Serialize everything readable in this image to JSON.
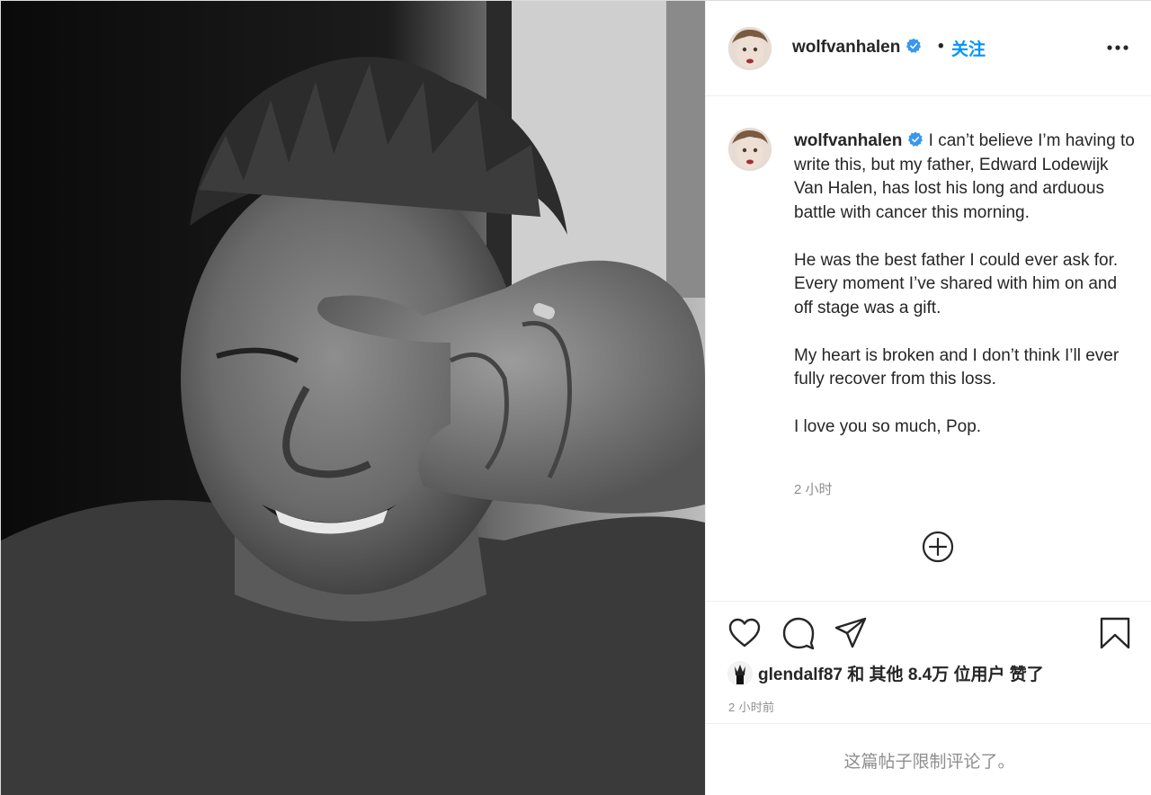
{
  "photo": {
    "description_icon": "photo-black-and-white"
  },
  "header": {
    "username": "wolfvanhalen",
    "separator": "•",
    "follow_label": "关注",
    "more_icon": "more-horizontal-icon"
  },
  "caption": {
    "username": "wolfvanhalen",
    "paragraphs": [
      "I can’t believe I’m having to write this, but my father, Edward Lodewijk Van Halen, has lost his long and arduous battle with cancer this morning.",
      "He was the best father I could ever ask for. Every moment I’ve shared with him on and off stage was a gift.",
      "My heart is broken and I don’t think I’ll ever fully recover from this loss.",
      "I love you so much, Pop."
    ],
    "time": "2 小时"
  },
  "actions": {
    "icons": [
      "heart-icon",
      "comment-icon",
      "share-icon",
      "bookmark-icon"
    ]
  },
  "likes": {
    "user": "glendalf87",
    "text_and": " 和 ",
    "text_others": "其他 8.4万 位用户",
    "text_liked": " 赞了"
  },
  "post_time": "2 小时前",
  "comments_restricted": "这篇帖子限制评论了。",
  "colors": {
    "accent": "#0095f6",
    "verified": "#3897f0",
    "muted": "#8e8e8e",
    "text": "#262626",
    "border": "#efefef"
  }
}
